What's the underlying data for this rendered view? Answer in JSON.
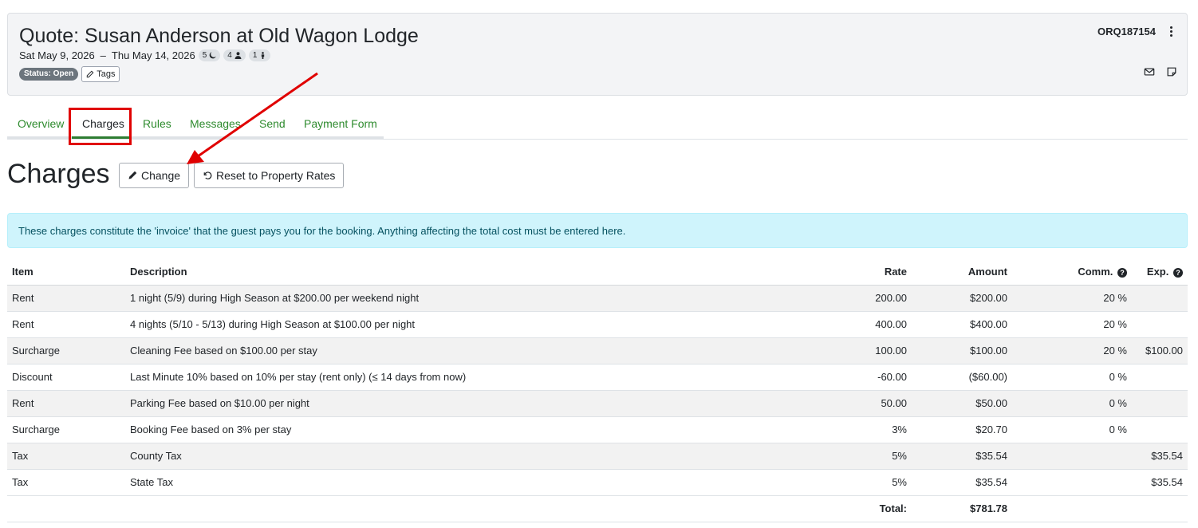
{
  "header": {
    "title": "Quote: Susan Anderson at Old Wagon Lodge",
    "start_date": "Sat May 9, 2026",
    "date_separator": "–",
    "end_date": "Thu May 14, 2026",
    "nights": "5",
    "adults": "4",
    "children": "1",
    "status": "Status: Open",
    "tags_label": "Tags",
    "quote_id": "ORQ187154"
  },
  "tabs": [
    {
      "label": "Overview"
    },
    {
      "label": "Charges"
    },
    {
      "label": "Rules"
    },
    {
      "label": "Messages"
    },
    {
      "label": "Send"
    },
    {
      "label": "Payment Form"
    }
  ],
  "active_tab": "Charges",
  "section": {
    "title": "Charges",
    "change_label": "Change",
    "reset_label": "Reset to Property Rates"
  },
  "info_message": "These charges constitute the 'invoice' that the guest pays you for the booking. Anything affecting the total cost must be entered here.",
  "table": {
    "columns": {
      "item": "Item",
      "description": "Description",
      "rate": "Rate",
      "amount": "Amount",
      "comm": "Comm.",
      "exp": "Exp."
    },
    "rows": [
      {
        "item": "Rent",
        "description": "1 night (5/9) during High Season at $200.00 per weekend night",
        "rate": "200.00",
        "amount": "$200.00",
        "comm": "20 %",
        "exp": ""
      },
      {
        "item": "Rent",
        "description": "4 nights (5/10 - 5/13) during High Season at $100.00 per night",
        "rate": "400.00",
        "amount": "$400.00",
        "comm": "20 %",
        "exp": ""
      },
      {
        "item": "Surcharge",
        "description": "Cleaning Fee based on $100.00 per stay",
        "rate": "100.00",
        "amount": "$100.00",
        "comm": "20 %",
        "exp": "$100.00"
      },
      {
        "item": "Discount",
        "description": "Last Minute 10% based on 10% per stay (rent only) (≤ 14 days from now)",
        "rate": "-60.00",
        "amount": "($60.00)",
        "comm": "0 %",
        "exp": ""
      },
      {
        "item": "Rent",
        "description": "Parking Fee based on $10.00 per night",
        "rate": "50.00",
        "amount": "$50.00",
        "comm": "0 %",
        "exp": ""
      },
      {
        "item": "Surcharge",
        "description": "Booking Fee based on 3% per stay",
        "rate": "3%",
        "amount": "$20.70",
        "comm": "0 %",
        "exp": ""
      },
      {
        "item": "Tax",
        "description": "County Tax",
        "rate": "5%",
        "amount": "$35.54",
        "comm": "",
        "exp": "$35.54"
      },
      {
        "item": "Tax",
        "description": "State Tax",
        "rate": "5%",
        "amount": "$35.54",
        "comm": "",
        "exp": "$35.54"
      }
    ],
    "total_label": "Total:",
    "total_amount": "$781.78"
  },
  "colors": {
    "tab_link": "#2e8b2e",
    "annotation_red": "#e00000",
    "info_bg": "#cff4fc",
    "info_text": "#055160",
    "status_badge": "#6c757d"
  },
  "icons": [
    "moon-icon",
    "person-icon",
    "child-icon",
    "pencil-icon",
    "kebab-menu-icon",
    "envelope-icon",
    "note-icon",
    "undo-icon",
    "question-circle-icon"
  ]
}
